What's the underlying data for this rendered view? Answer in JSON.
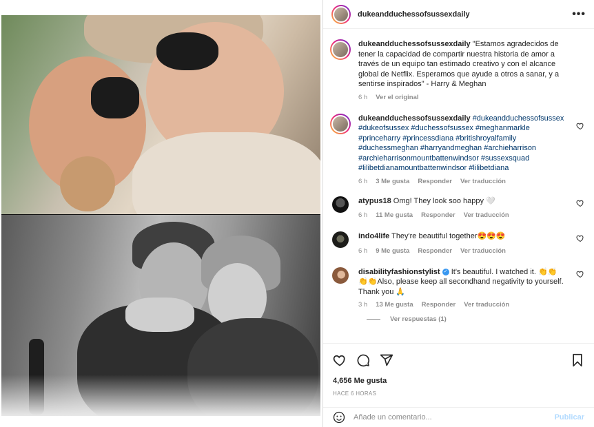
{
  "post": {
    "username": "dukeandduchessofsussexdaily",
    "more_icon": "more-dots-icon"
  },
  "caption": {
    "username": "dukeandduchessofsussexdaily",
    "text": "\"Estamos agradecidos de tener la capacidad de compartir nuestra historia de amor a través de un equipo tan estimado creativo y con el alcance global de Netflix. Esperamos que ayude a otros a sanar, y a sentirse inspirados\" - Harry & Meghan",
    "time": "6 h",
    "see_original": "Ver el original"
  },
  "comments": [
    {
      "username": "dukeandduchessofsussexdaily",
      "text": "#dukeandduchessofsussex #dukeofsussex #duchessofsussex #meghanmarkle #princeharry #princessdiana #britishroyalfamily #duchessmeghan #harryandmeghan #archieharrison #archieharrisonmountbattenwindsor #sussexsquad #lilibetdianamountbattenwindsor #lilibetdiana",
      "time": "6 h",
      "likes": "3 Me gusta",
      "reply": "Responder",
      "translate": "Ver traducción"
    },
    {
      "username": "atypus18",
      "text": "Omg! They look soo happy 🤍",
      "time": "6 h",
      "likes": "11 Me gusta",
      "reply": "Responder",
      "translate": "Ver traducción"
    },
    {
      "username": "indo4life",
      "text": "They're beautiful together😍😍😍",
      "time": "6 h",
      "likes": "9 Me gusta",
      "reply": "Responder",
      "translate": "Ver traducción"
    },
    {
      "username": "disabilityfashionstylist",
      "text": "It's beautiful. I watched it. 👏👏👏👏Also, please keep all secondhand negativity to yourself. Thank you 🙏",
      "time": "3 h",
      "likes": "13 Me gusta",
      "reply": "Responder",
      "translate": "Ver traducción",
      "view_replies": "Ver respuestas (1)"
    }
  ],
  "actions": {
    "like_icon": "heart-icon",
    "comment_icon": "comment-icon",
    "share_icon": "share-icon",
    "save_icon": "bookmark-icon"
  },
  "likes_count": "4,656 Me gusta",
  "timestamp": "HACE 6 HORAS",
  "add_comment": {
    "emoji_icon": "smiley-icon",
    "placeholder": "Añade un comentario...",
    "publish": "Publicar"
  },
  "colors": {
    "link": "#00376b",
    "secondary": "#8e8e8e",
    "publish_disabled": "#b3dbff"
  }
}
